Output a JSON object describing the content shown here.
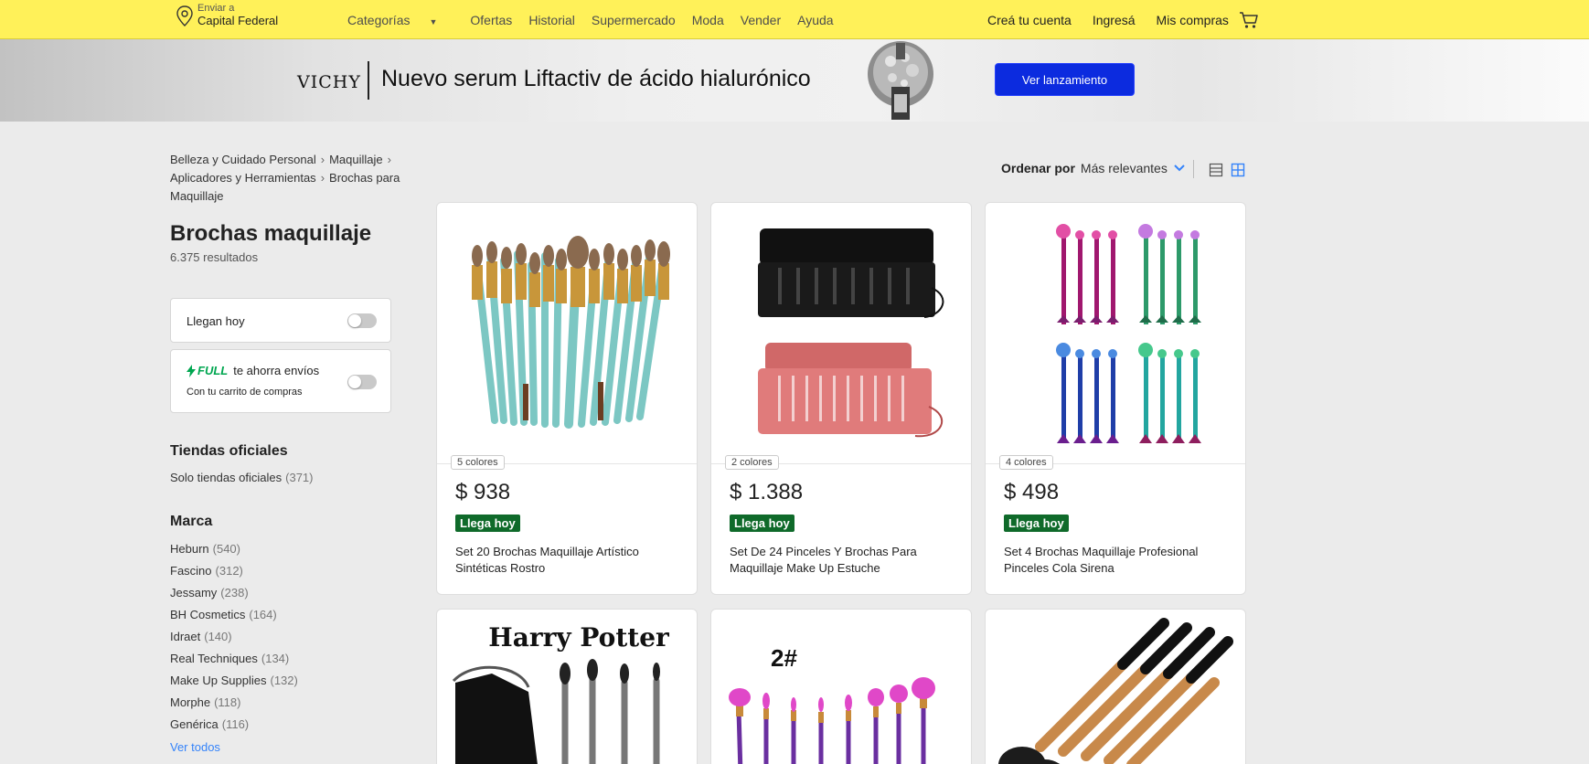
{
  "header": {
    "location_small": "Enviar a",
    "location_big": "Capital Federal",
    "nav": [
      "Categorías",
      "Ofertas",
      "Historial",
      "Supermercado",
      "Moda",
      "Vender",
      "Ayuda"
    ],
    "account": [
      "Creá tu cuenta",
      "Ingresá",
      "Mis compras"
    ],
    "cart_icon": "cart-icon"
  },
  "banner": {
    "brand": "VICHY",
    "title": "Nuevo serum Liftactiv de ácido hialurónico",
    "button": "Ver lanzamiento"
  },
  "breadcrumb": [
    "Belleza y Cuidado Personal",
    "Maquillaje",
    "Aplicadores y Herramientas",
    "Brochas para Maquillaje"
  ],
  "search": {
    "title": "Brochas maquillaje",
    "results": "6.375 resultados"
  },
  "filters": {
    "llegan_hoy": "Llegan hoy",
    "full_word": "FULL",
    "full_text": "te ahorra envíos",
    "full_sub": "Con tu carrito de compras",
    "tiendas_title": "Tiendas oficiales",
    "tiendas_item": {
      "label": "Solo tiendas oficiales",
      "count": "(371)"
    },
    "marca_title": "Marca",
    "marcas": [
      {
        "label": "Heburn",
        "count": "(540)"
      },
      {
        "label": "Fascino",
        "count": "(312)"
      },
      {
        "label": "Jessamy",
        "count": "(238)"
      },
      {
        "label": "BH Cosmetics",
        "count": "(164)"
      },
      {
        "label": "Idraet",
        "count": "(140)"
      },
      {
        "label": "Real Techniques",
        "count": "(134)"
      },
      {
        "label": "Make Up Supplies",
        "count": "(132)"
      },
      {
        "label": "Morphe",
        "count": "(118)"
      },
      {
        "label": "Genérica",
        "count": "(116)"
      }
    ],
    "ver_todos": "Ver todos"
  },
  "sort": {
    "label": "Ordenar por",
    "value": "Más relevantes"
  },
  "products": [
    {
      "colors": "5 colores",
      "price": "$ 938",
      "badge": "Llega hoy",
      "name": "Set 20 Brochas Maquillaje Artístico Sintéticas Rostro"
    },
    {
      "colors": "2 colores",
      "price": "$ 1.388",
      "badge": "Llega hoy",
      "name": "Set De 24 Pinceles Y Brochas Para Maquillaje Make Up Estuche"
    },
    {
      "colors": "4 colores",
      "price": "$ 498",
      "badge": "Llega hoy",
      "name": "Set 4 Brochas Maquillaje Profesional Pinceles Cola Sirena"
    },
    {
      "image_text": "Harry Potter"
    },
    {
      "image_text": "2#"
    },
    {}
  ],
  "colors": {
    "header_yellow": "#fff159",
    "banner_button": "#0c2bdf",
    "badge_green": "#0f6a2a",
    "link_blue": "#3483fa",
    "full_green": "#00a650"
  }
}
